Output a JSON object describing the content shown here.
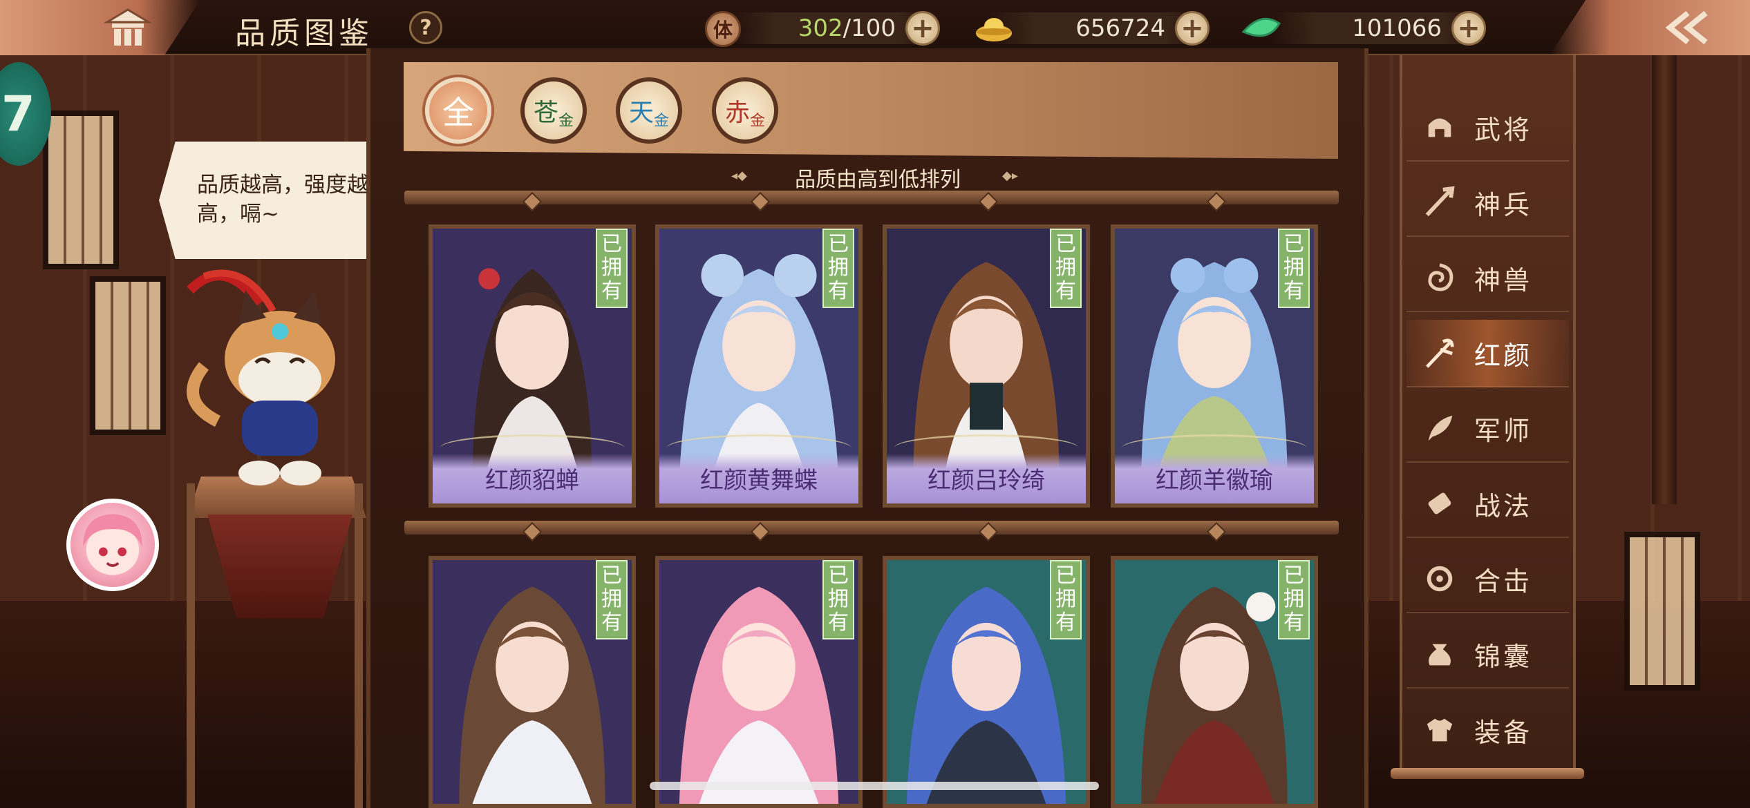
{
  "header": {
    "title": "品质图鉴",
    "help": "?",
    "stamina": {
      "icon": "体",
      "current": "302",
      "max": "/100"
    },
    "gold": {
      "value": "656724"
    },
    "jade": {
      "value": "101066"
    },
    "plus": "+"
  },
  "filters": [
    {
      "label": "全",
      "active": true
    },
    {
      "label": "苍",
      "sub": "金"
    },
    {
      "label": "天",
      "sub": "金"
    },
    {
      "label": "赤",
      "sub": "金"
    }
  ],
  "sort_label": "品质由高到低排列",
  "tip": "品质越高，强度越高，嗝~",
  "side_badge": "7",
  "owned_label": "已拥有",
  "cards": [
    {
      "name": "红颜貂蝉",
      "theme": "purple"
    },
    {
      "name": "红颜黄舞蝶",
      "theme": "purple"
    },
    {
      "name": "红颜吕玲绮",
      "theme": "purple"
    },
    {
      "name": "红颜羊徽瑜",
      "theme": "purple"
    },
    {
      "name": "",
      "theme": "purple"
    },
    {
      "name": "",
      "theme": "purple"
    },
    {
      "name": "",
      "theme": "teal"
    },
    {
      "name": "",
      "theme": "teal"
    }
  ],
  "nav": [
    {
      "label": "武将",
      "icon": "helmet-icon"
    },
    {
      "label": "神兵",
      "icon": "weapon-icon"
    },
    {
      "label": "神兽",
      "icon": "beast-icon"
    },
    {
      "label": "红颜",
      "icon": "hairpin-icon",
      "active": true
    },
    {
      "label": "军师",
      "icon": "feather-icon"
    },
    {
      "label": "战法",
      "icon": "scroll-icon"
    },
    {
      "label": "合击",
      "icon": "combo-icon"
    },
    {
      "label": "锦囊",
      "icon": "pouch-icon"
    },
    {
      "label": "装备",
      "icon": "armor-icon"
    }
  ]
}
